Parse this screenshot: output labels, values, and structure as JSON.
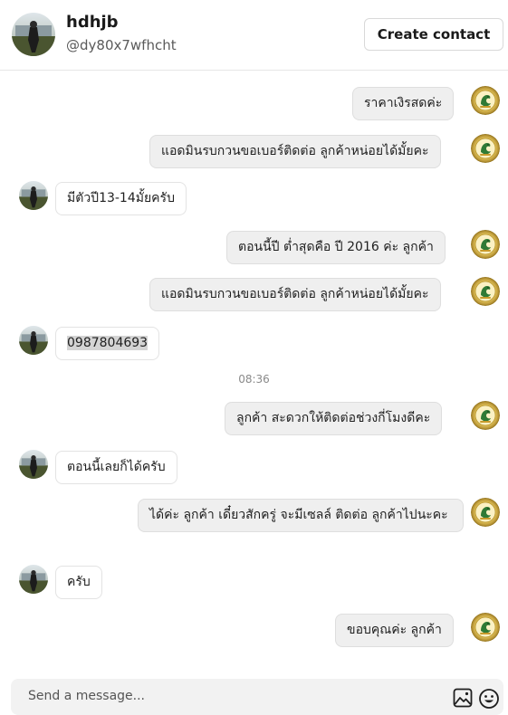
{
  "header": {
    "name": "hdhjb",
    "handle": "@dy80x7wfhcht",
    "create_contact_label": "Create contact"
  },
  "messages": [
    {
      "direction": "out",
      "text": "ราคาเงิรสดค่ะ"
    },
    {
      "direction": "out",
      "text": "แอดมินรบกวนขอเบอร์ติดต่อ ลูกค้าหน่อยได้มั้ยคะ"
    },
    {
      "direction": "in",
      "text": "มีตัวปี13-14มั้ยครับ"
    },
    {
      "direction": "out",
      "text": "ตอนนี้ปี ต่ำสุดคือ  ปี 2016 ค่ะ ลูกค้า"
    },
    {
      "direction": "out",
      "text": "แอดมินรบกวนขอเบอร์ติดต่อ ลูกค้าหน่อยได้มั้ยคะ"
    },
    {
      "direction": "in",
      "text": "0987804693"
    },
    {
      "direction": "out",
      "text": "ลูกค้า สะดวกให้ติดต่อช่วงกี่โมงดีคะ"
    },
    {
      "direction": "in",
      "text": "ตอนนี้เลยก็ได้ครับ"
    },
    {
      "direction": "out",
      "text": "ได้ค่ะ ลูกค้า เดี๋ยวสักครู่ จะมีเซลล์ ติดต่อ ลูกค้าไปนะคะ"
    },
    {
      "direction": "in",
      "text": "ครับ"
    },
    {
      "direction": "out",
      "text": "ขอบคุณค่ะ ลูกค้า"
    }
  ],
  "timestamp": "08:36",
  "composer": {
    "placeholder": "Send a message...",
    "icons": [
      "image-icon",
      "emoji-icon"
    ]
  },
  "colors": {
    "outgoing_bubble": "#efefef",
    "incoming_bubble": "#ffffff",
    "border": "#e6e6e6"
  }
}
